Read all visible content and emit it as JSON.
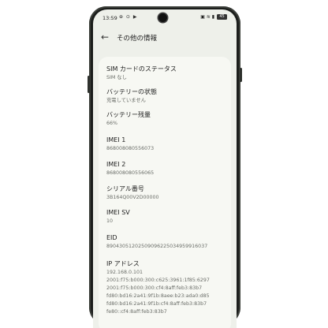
{
  "status_bar": {
    "time": "13:59",
    "left_icons": "⊕ ⊙ ▶",
    "right_icons": "▣ ≋ ▮",
    "battery": "45"
  },
  "header": {
    "title": "その他の情報"
  },
  "items": [
    {
      "label": "SIM カードのステータス",
      "value": [
        "SIM なし"
      ]
    },
    {
      "label": "バッテリーの状態",
      "value": [
        "充電していません"
      ]
    },
    {
      "label": "バッテリー残量",
      "value": [
        "66%"
      ]
    },
    {
      "label": "IMEI 1",
      "value": [
        "868008080556073"
      ]
    },
    {
      "label": "IMEI 2",
      "value": [
        "868008080556065"
      ]
    },
    {
      "label": "シリアル番号",
      "value": [
        "3B164Q00V2D00000"
      ]
    },
    {
      "label": "IMEI SV",
      "value": [
        "10"
      ]
    },
    {
      "label": "EID",
      "value": [
        "89043051202509096225034959916037"
      ]
    },
    {
      "label": "IP アドレス",
      "value": [
        "192.168.0.101",
        "2001:f75:b000:300:c625:3961:1f85:6297",
        "2001:f75:b000:300:cf4:8aff:feb3:83b7",
        "fd80:bd16:2a41:9f1b:8aee:b23:ada0:d85",
        "fd80:bd16:2a41:9f1b:cf4:8aff:feb3:83b7",
        "fe80::cf4:8aff:feb3:83b7"
      ]
    }
  ]
}
